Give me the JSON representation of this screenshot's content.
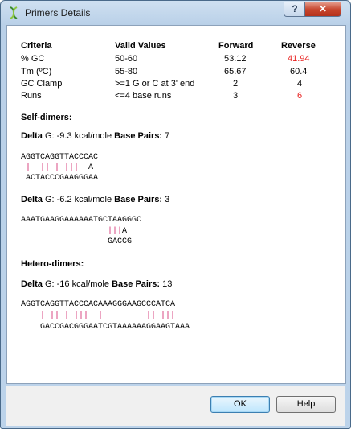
{
  "window": {
    "title": "Primers Details"
  },
  "titlebar_buttons": {
    "help": "?",
    "close": "✕"
  },
  "table": {
    "headers": {
      "criteria": "Criteria",
      "valid": "Valid Values",
      "forward": "Forward",
      "reverse": "Reverse"
    },
    "rows": [
      {
        "criteria": "% GC",
        "valid": "50-60",
        "forward": "53.12",
        "reverse": "41.94",
        "reverse_fail": true
      },
      {
        "criteria": "Tm (ºC)",
        "valid": "55-80",
        "forward": "65.67",
        "reverse": "60.4",
        "reverse_fail": false
      },
      {
        "criteria": "GC Clamp",
        "valid": ">=1 G or C at 3' end",
        "forward": "2",
        "reverse": "4",
        "reverse_fail": false
      },
      {
        "criteria": "Runs",
        "valid": "<=4 base runs",
        "forward": "3",
        "reverse": "6",
        "reverse_fail": true
      }
    ]
  },
  "self_dimers": {
    "heading": "Self-dimers:",
    "items": [
      {
        "delta_label": "Delta",
        "delta_value": " G: -9.3 kcal/mole ",
        "bp_label": "Base Pairs:",
        "bp_value": " 7",
        "top": "AGGTCAGGTTACCCAC",
        "marks": " |  || | |||  ",
        "marks_tail": "A",
        "bottom": " ACTACCCGAAGGGAA"
      },
      {
        "delta_label": "Delta",
        "delta_value": " G: -6.2 kcal/mole ",
        "bp_label": "Base Pairs:",
        "bp_value": " 3",
        "top": "AAATGAAGGAAAAAATGCTAAGGGC",
        "marks": "                  |||",
        "marks_tail": "A",
        "bottom": "                  GACCG"
      }
    ]
  },
  "hetero_dimers": {
    "heading": "Hetero-dimers:",
    "items": [
      {
        "delta_label": "Delta",
        "delta_value": " G: -16 kcal/mole ",
        "bp_label": "Base Pairs:",
        "bp_value": " 13",
        "top": "AGGTCAGGTTACCCACAAAGGGAAGCCCATCA",
        "marks": "    | || | |||  |         || |||",
        "marks_tail": "",
        "bottom": "    GACCGACGGGAATCGTAAAAAAGGAAGTAAA"
      }
    ]
  },
  "buttons": {
    "ok": "OK",
    "help": "Help"
  },
  "colors": {
    "fail": "#e8211f",
    "match_marks": "#d0246a",
    "ok_border": "#3c7fb1"
  },
  "icons": {
    "app": "dna-helix-icon"
  }
}
